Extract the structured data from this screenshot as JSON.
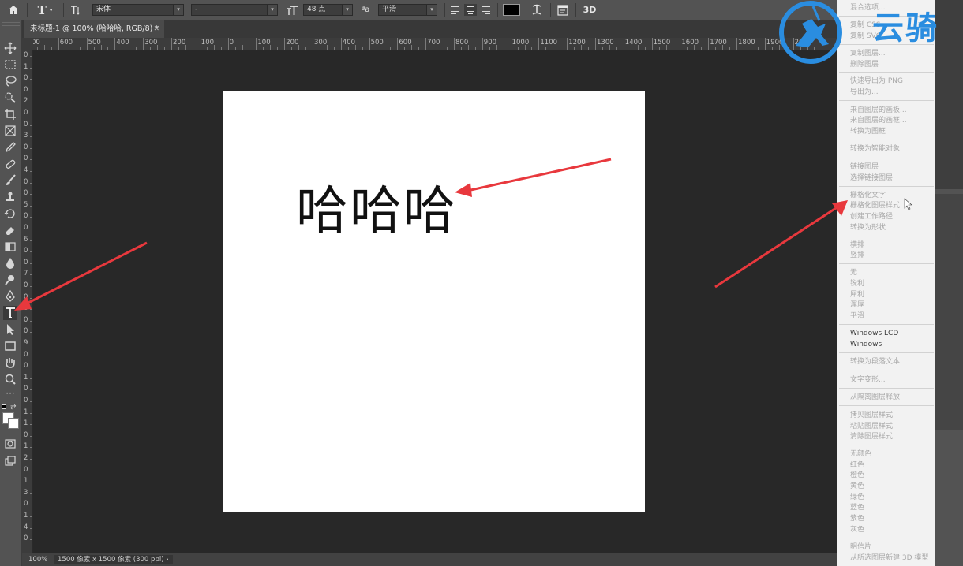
{
  "optionbar": {
    "font_family": "宋体",
    "font_style": "-",
    "font_size": "48 点",
    "aa_label": "ªa",
    "antialias": "平滑",
    "threed_label": "3D"
  },
  "document": {
    "tab_title": "未标题-1 @ 100% (哈哈哈, RGB/8) *",
    "canvas_text": "哈哈哈"
  },
  "status": {
    "zoom": "100%",
    "info": "1500 像素 x 1500 像素 (300 ppi)"
  },
  "ruler": {
    "h_ticks": [
      "00",
      "600",
      "500",
      "400",
      "300",
      "200",
      "100",
      "0",
      "100",
      "200",
      "300",
      "400",
      "500",
      "600",
      "700",
      "800",
      "900",
      "1000",
      "1100",
      "1200",
      "1300",
      "1400",
      "1500",
      "1600",
      "1700",
      "1800",
      "1900",
      "200"
    ],
    "v_ticks": [
      "0",
      "1",
      "0",
      "0",
      "2",
      "0",
      "0",
      "3",
      "0",
      "0",
      "4",
      "0",
      "0",
      "5",
      "0",
      "0",
      "6",
      "0",
      "0",
      "7",
      "0",
      "0",
      "8",
      "0",
      "0",
      "9",
      "0",
      "0",
      "1",
      "0",
      "0",
      "1",
      "1",
      "0",
      "1",
      "2",
      "0",
      "1",
      "3",
      "0",
      "1",
      "4",
      "0"
    ]
  },
  "menu": {
    "items": [
      {
        "label": "混合选项...",
        "enabled": false
      },
      {
        "label": "复制 CSS",
        "enabled": false
      },
      {
        "label": "复制 SVG",
        "enabled": false
      },
      {
        "label": "复制图层...",
        "enabled": false
      },
      {
        "label": "删除图层",
        "enabled": false
      },
      {
        "label": "快速导出为 PNG",
        "enabled": false
      },
      {
        "label": "导出为...",
        "enabled": false
      },
      {
        "label": "来自图层的画板...",
        "enabled": false
      },
      {
        "label": "来自图层的画框...",
        "enabled": false
      },
      {
        "label": "转换为图框",
        "enabled": false
      },
      {
        "label": "转换为智能对象",
        "enabled": false
      },
      {
        "label": "链接图层",
        "enabled": false
      },
      {
        "label": "选择链接图层",
        "enabled": false
      },
      {
        "label": "栅格化文字",
        "enabled": false
      },
      {
        "label": "栅格化图层样式",
        "enabled": false
      },
      {
        "label": "创建工作路径",
        "enabled": false
      },
      {
        "label": "转换为形状",
        "enabled": false
      },
      {
        "label": "横排",
        "enabled": false
      },
      {
        "label": "竖排",
        "enabled": false
      },
      {
        "label": "无",
        "enabled": false
      },
      {
        "label": "锐利",
        "enabled": false
      },
      {
        "label": "犀利",
        "enabled": false
      },
      {
        "label": "浑厚",
        "enabled": false
      },
      {
        "label": "平滑",
        "enabled": false
      },
      {
        "label": "Windows LCD",
        "enabled": true
      },
      {
        "label": "Windows",
        "enabled": true
      },
      {
        "label": "转换为段落文本",
        "enabled": false
      },
      {
        "label": "文字变形...",
        "enabled": false
      },
      {
        "label": "从隔离图层释放",
        "enabled": false
      },
      {
        "label": "拷贝图层样式",
        "enabled": false
      },
      {
        "label": "粘贴图层样式",
        "enabled": false
      },
      {
        "label": "清除图层样式",
        "enabled": false
      },
      {
        "label": "无颜色",
        "enabled": false
      },
      {
        "label": "红色",
        "enabled": false
      },
      {
        "label": "橙色",
        "enabled": false
      },
      {
        "label": "黄色",
        "enabled": false
      },
      {
        "label": "绿色",
        "enabled": false
      },
      {
        "label": "蓝色",
        "enabled": false
      },
      {
        "label": "紫色",
        "enabled": false
      },
      {
        "label": "灰色",
        "enabled": false
      },
      {
        "label": "明信片",
        "enabled": false
      },
      {
        "label": "从所选图层新建 3D 模型",
        "enabled": false
      }
    ]
  },
  "watermark": {
    "text": "云骑"
  },
  "colors": {
    "accent_red": "#e8383d",
    "watermark_blue": "#2a8de0",
    "ui_panel": "#535353",
    "workspace": "#282828"
  },
  "icons": [
    "home-icon",
    "text-tool-icon",
    "text-orientation-icon",
    "font-size-icon",
    "align-left-icon",
    "align-center-icon",
    "align-right-icon",
    "warp-text-icon",
    "character-panel-icon",
    "move-tool-icon",
    "marquee-tool-icon",
    "lasso-tool-icon",
    "quick-select-tool-icon",
    "crop-tool-icon",
    "frame-tool-icon",
    "eyedropper-tool-icon",
    "healing-brush-icon",
    "brush-tool-icon",
    "clone-stamp-icon",
    "history-brush-icon",
    "eraser-tool-icon",
    "gradient-tool-icon",
    "blur-tool-icon",
    "dodge-tool-icon",
    "pen-tool-icon",
    "type-tool-icon",
    "path-select-icon",
    "rectangle-tool-icon",
    "hand-tool-icon",
    "zoom-tool-icon",
    "more-tools-icon"
  ]
}
